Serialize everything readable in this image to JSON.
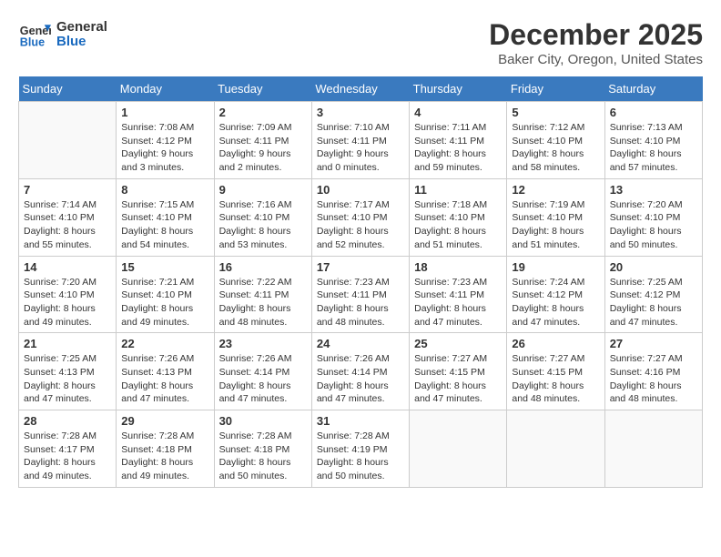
{
  "logo": {
    "line1": "General",
    "line2": "Blue"
  },
  "title": "December 2025",
  "location": "Baker City, Oregon, United States",
  "weekdays": [
    "Sunday",
    "Monday",
    "Tuesday",
    "Wednesday",
    "Thursday",
    "Friday",
    "Saturday"
  ],
  "weeks": [
    [
      {
        "day": "",
        "info": ""
      },
      {
        "day": "1",
        "info": "Sunrise: 7:08 AM\nSunset: 4:12 PM\nDaylight: 9 hours\nand 3 minutes."
      },
      {
        "day": "2",
        "info": "Sunrise: 7:09 AM\nSunset: 4:11 PM\nDaylight: 9 hours\nand 2 minutes."
      },
      {
        "day": "3",
        "info": "Sunrise: 7:10 AM\nSunset: 4:11 PM\nDaylight: 9 hours\nand 0 minutes."
      },
      {
        "day": "4",
        "info": "Sunrise: 7:11 AM\nSunset: 4:11 PM\nDaylight: 8 hours\nand 59 minutes."
      },
      {
        "day": "5",
        "info": "Sunrise: 7:12 AM\nSunset: 4:10 PM\nDaylight: 8 hours\nand 58 minutes."
      },
      {
        "day": "6",
        "info": "Sunrise: 7:13 AM\nSunset: 4:10 PM\nDaylight: 8 hours\nand 57 minutes."
      }
    ],
    [
      {
        "day": "7",
        "info": "Sunrise: 7:14 AM\nSunset: 4:10 PM\nDaylight: 8 hours\nand 55 minutes."
      },
      {
        "day": "8",
        "info": "Sunrise: 7:15 AM\nSunset: 4:10 PM\nDaylight: 8 hours\nand 54 minutes."
      },
      {
        "day": "9",
        "info": "Sunrise: 7:16 AM\nSunset: 4:10 PM\nDaylight: 8 hours\nand 53 minutes."
      },
      {
        "day": "10",
        "info": "Sunrise: 7:17 AM\nSunset: 4:10 PM\nDaylight: 8 hours\nand 52 minutes."
      },
      {
        "day": "11",
        "info": "Sunrise: 7:18 AM\nSunset: 4:10 PM\nDaylight: 8 hours\nand 51 minutes."
      },
      {
        "day": "12",
        "info": "Sunrise: 7:19 AM\nSunset: 4:10 PM\nDaylight: 8 hours\nand 51 minutes."
      },
      {
        "day": "13",
        "info": "Sunrise: 7:20 AM\nSunset: 4:10 PM\nDaylight: 8 hours\nand 50 minutes."
      }
    ],
    [
      {
        "day": "14",
        "info": "Sunrise: 7:20 AM\nSunset: 4:10 PM\nDaylight: 8 hours\nand 49 minutes."
      },
      {
        "day": "15",
        "info": "Sunrise: 7:21 AM\nSunset: 4:10 PM\nDaylight: 8 hours\nand 49 minutes."
      },
      {
        "day": "16",
        "info": "Sunrise: 7:22 AM\nSunset: 4:11 PM\nDaylight: 8 hours\nand 48 minutes."
      },
      {
        "day": "17",
        "info": "Sunrise: 7:23 AM\nSunset: 4:11 PM\nDaylight: 8 hours\nand 48 minutes."
      },
      {
        "day": "18",
        "info": "Sunrise: 7:23 AM\nSunset: 4:11 PM\nDaylight: 8 hours\nand 47 minutes."
      },
      {
        "day": "19",
        "info": "Sunrise: 7:24 AM\nSunset: 4:12 PM\nDaylight: 8 hours\nand 47 minutes."
      },
      {
        "day": "20",
        "info": "Sunrise: 7:25 AM\nSunset: 4:12 PM\nDaylight: 8 hours\nand 47 minutes."
      }
    ],
    [
      {
        "day": "21",
        "info": "Sunrise: 7:25 AM\nSunset: 4:13 PM\nDaylight: 8 hours\nand 47 minutes."
      },
      {
        "day": "22",
        "info": "Sunrise: 7:26 AM\nSunset: 4:13 PM\nDaylight: 8 hours\nand 47 minutes."
      },
      {
        "day": "23",
        "info": "Sunrise: 7:26 AM\nSunset: 4:14 PM\nDaylight: 8 hours\nand 47 minutes."
      },
      {
        "day": "24",
        "info": "Sunrise: 7:26 AM\nSunset: 4:14 PM\nDaylight: 8 hours\nand 47 minutes."
      },
      {
        "day": "25",
        "info": "Sunrise: 7:27 AM\nSunset: 4:15 PM\nDaylight: 8 hours\nand 47 minutes."
      },
      {
        "day": "26",
        "info": "Sunrise: 7:27 AM\nSunset: 4:15 PM\nDaylight: 8 hours\nand 48 minutes."
      },
      {
        "day": "27",
        "info": "Sunrise: 7:27 AM\nSunset: 4:16 PM\nDaylight: 8 hours\nand 48 minutes."
      }
    ],
    [
      {
        "day": "28",
        "info": "Sunrise: 7:28 AM\nSunset: 4:17 PM\nDaylight: 8 hours\nand 49 minutes."
      },
      {
        "day": "29",
        "info": "Sunrise: 7:28 AM\nSunset: 4:18 PM\nDaylight: 8 hours\nand 49 minutes."
      },
      {
        "day": "30",
        "info": "Sunrise: 7:28 AM\nSunset: 4:18 PM\nDaylight: 8 hours\nand 50 minutes."
      },
      {
        "day": "31",
        "info": "Sunrise: 7:28 AM\nSunset: 4:19 PM\nDaylight: 8 hours\nand 50 minutes."
      },
      {
        "day": "",
        "info": ""
      },
      {
        "day": "",
        "info": ""
      },
      {
        "day": "",
        "info": ""
      }
    ]
  ]
}
